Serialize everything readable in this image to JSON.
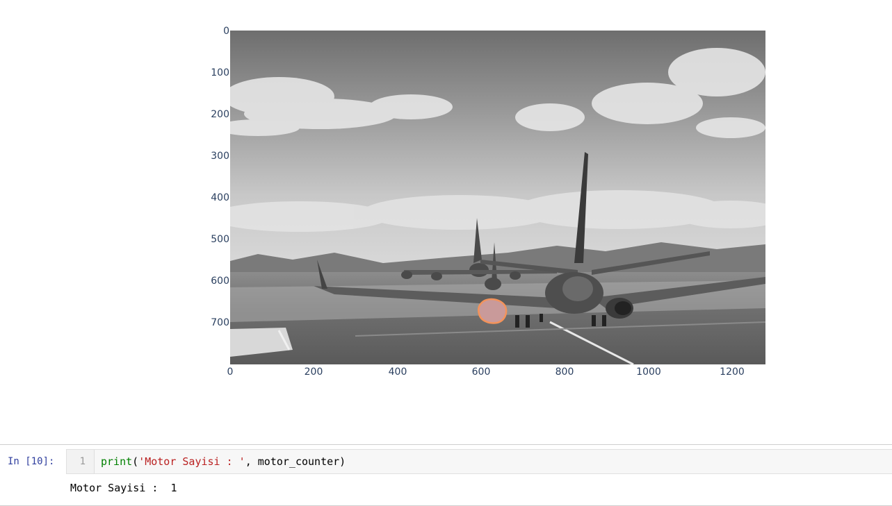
{
  "figure": {
    "y_ticks": [
      "0",
      "100",
      "200",
      "300",
      "400",
      "500",
      "600",
      "700"
    ],
    "x_ticks": [
      "0",
      "200",
      "400",
      "600",
      "800",
      "1000",
      "1200"
    ],
    "image_description_icon": "grayscale-airport-runway-photo",
    "highlight_color": "#f4935a"
  },
  "cell": {
    "prompt": "In [10]:",
    "line_number": "1",
    "code_tokens": {
      "fn": "print",
      "open": "(",
      "str": "'Motor Sayisi : '",
      "rest": ", motor_counter)"
    },
    "output": "Motor Sayisi :  1"
  }
}
